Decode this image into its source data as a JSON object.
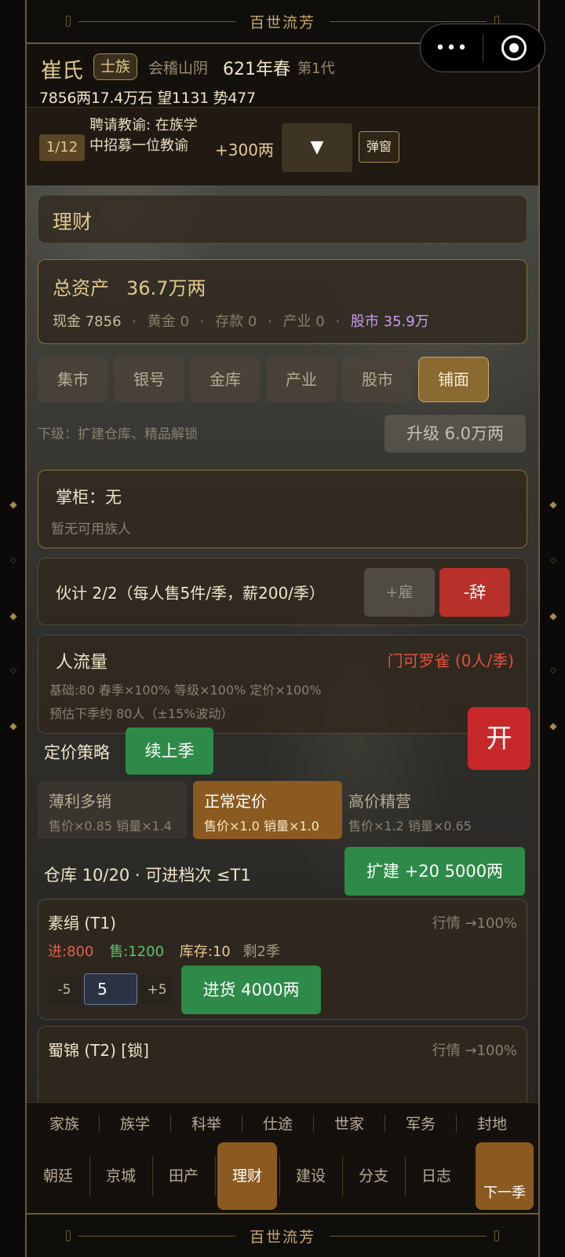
{
  "game_title": "百世流芳",
  "header": {
    "clan_name": "崔氏",
    "rank_badge": "士族",
    "place": "会稽山阴",
    "year": "621年春",
    "generation": "第1代",
    "resources": "7856两17.4万石  望1131 势477"
  },
  "capsule": {
    "more_icon": "•••"
  },
  "task": {
    "count": "1/12",
    "description": "聘请教谕: 在族学中招募一位教谕",
    "reward": "+300两",
    "dropdown_icon": "▼",
    "popup_label": "弹窗"
  },
  "section_title": "理财",
  "assets": {
    "label": "总资产",
    "value": "36.7万两",
    "cash": "现金 7856",
    "gold": "黄金 0",
    "deposit": "存款 0",
    "property": "产业 0",
    "stock": "股市 35.9万",
    "sep": "·"
  },
  "tabs": [
    "集市",
    "银号",
    "金库",
    "产业",
    "股市",
    "铺面"
  ],
  "active_tab": 5,
  "next_level": "下级：扩建仓库、精品解锁",
  "upgrade_label": "升级 6.0万两",
  "manager": {
    "name": "掌柜：无",
    "sub": "暂无可用族人"
  },
  "clerks": {
    "text": "伙计 2/2（每人售5件/季，薪200/季）",
    "hire_label": "+雇",
    "fire_label": "-辞"
  },
  "traffic": {
    "title": "人流量",
    "alert": "门可罗雀 (0人/季)",
    "line1": "基础:80  春季×100%  等级×100%  定价×100%",
    "line2": "预估下季约 80人（±15%波动）"
  },
  "pricing": {
    "label": "定价策略",
    "continue_label": "续上季",
    "options": [
      {
        "name": "薄利多销",
        "desc": "售价×0.85 销量×1.4"
      },
      {
        "name": "正常定价",
        "desc": "售价×1.0 销量×1.0"
      },
      {
        "name": "高价精营",
        "desc": "售价×1.2 销量×0.65"
      }
    ],
    "active": 1
  },
  "warehouse": {
    "text": "仓库 10/20  ·  可进档次 ≤T1",
    "expand_label": "扩建 +20 5000两"
  },
  "items": [
    {
      "name": "素绢 (T1)",
      "market": "行情 →100%",
      "buy": "进:800",
      "sell": "售:1200",
      "stock": "库存:10",
      "left": "剩2季",
      "minus_label": "-5",
      "qty": "5",
      "plus_label": "+5",
      "stock_btn": "进货 4000两"
    },
    {
      "name": "蜀锦 (T2) [锁]",
      "market": "行情 →100%"
    }
  ],
  "open_label": "开",
  "nav_row1": [
    "家族",
    "族学",
    "科举",
    "仕途",
    "世家",
    "军务",
    "封地"
  ],
  "nav_row2": [
    "朝廷",
    "京城",
    "田产",
    "理财",
    "建设",
    "分支",
    "日志"
  ],
  "nav_active": 3,
  "next_season": "下一季"
}
